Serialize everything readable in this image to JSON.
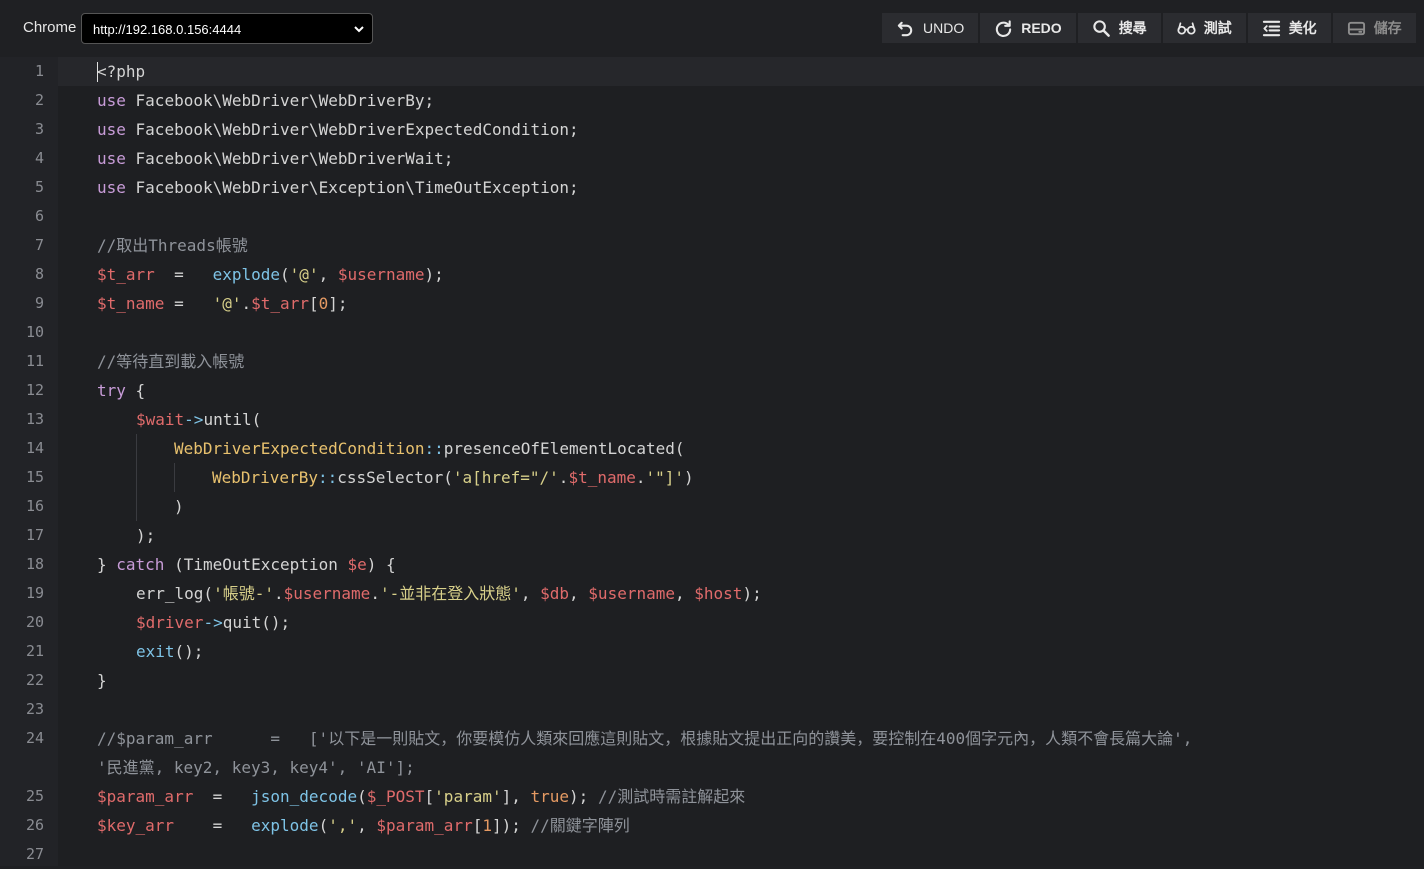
{
  "header": {
    "app_label": "Chrome",
    "url": "http://192.168.0.156:4444"
  },
  "toolbar": {
    "undo": "UNDO",
    "redo": "REDO",
    "search": "搜尋",
    "test": "測試",
    "beautify": "美化",
    "save": "儲存"
  },
  "editor": {
    "line_numbers": [
      "1",
      "2",
      "3",
      "4",
      "5",
      "6",
      "7",
      "8",
      "9",
      "10",
      "11",
      "12",
      "13",
      "14",
      "15",
      "16",
      "17",
      "18",
      "19",
      "20",
      "21",
      "22",
      "23",
      "24",
      "25",
      "26",
      "27"
    ],
    "code": {
      "l1": "<?php",
      "l2_kw": "use",
      "l2_rest": " Facebook\\WebDriver\\WebDriverBy;",
      "l3_kw": "use",
      "l3_rest": " Facebook\\WebDriver\\WebDriverExpectedCondition;",
      "l4_kw": "use",
      "l4_rest": " Facebook\\WebDriver\\WebDriverWait;",
      "l5_kw": "use",
      "l5_rest": " Facebook\\WebDriver\\Exception\\TimeOutException;",
      "l7": "//取出Threads帳號",
      "l8_var": "$t_arr",
      "l8_eq": "  =   ",
      "l8_fn": "explode",
      "l8_p1": "(",
      "l8_str": "'@'",
      "l8_p2": ", ",
      "l8_var2": "$username",
      "l8_p3": ");",
      "l9_var": "$t_name",
      "l9_eq": " =   ",
      "l9_str": "'@'",
      "l9_p1": ".",
      "l9_var2": "$t_arr",
      "l9_p2": "[",
      "l9_num": "0",
      "l9_p3": "];",
      "l11": "//等待直到載入帳號",
      "l12_kw": "try",
      "l12_rest": " {",
      "l13_var": "$wait",
      "l13_op": "->",
      "l13_rest": "until(",
      "l14_cls": "WebDriverExpectedCondition",
      "l14_op": "::",
      "l14_rest": "presenceOfElementLocated(",
      "l15_cls": "WebDriverBy",
      "l15_op": "::",
      "l15_p1": "cssSelector(",
      "l15_str1": "'a[href=\"/'",
      "l15_p2": ".",
      "l15_var": "$t_name",
      "l15_p3": ".",
      "l15_str2": "'\"]'",
      "l15_p4": ")",
      "l16": ")",
      "l17": ");",
      "l18_p1": "} ",
      "l18_kw": "catch",
      "l18_p2": " (TimeOutException ",
      "l18_var": "$e",
      "l18_p3": ") {",
      "l19_p1": "err_log(",
      "l19_str1": "'帳號-'",
      "l19_p2": ".",
      "l19_var1": "$username",
      "l19_p3": ".",
      "l19_str2": "'-並非在登入狀態'",
      "l19_p4": ", ",
      "l19_var2": "$db",
      "l19_p5": ", ",
      "l19_var3": "$username",
      "l19_p6": ", ",
      "l19_var4": "$host",
      "l19_p7": ");",
      "l20_var": "$driver",
      "l20_op": "->",
      "l20_rest": "quit();",
      "l21_fn": "exit",
      "l21_rest": "();",
      "l22": "}",
      "l24a": "//$param_arr      =   ['以下是一則貼文，你要模仿人類來回應這則貼文，根據貼文提出正向的讚美，要控制在400個字元內，人類不會長篇大論',",
      "l24b": "'民進黨, key2, key3, key4', 'AI'];",
      "l25_var": "$param_arr",
      "l25_eq": "  =   ",
      "l25_fn": "json_decode",
      "l25_p1": "(",
      "l25_var2": "$_POST",
      "l25_p2": "[",
      "l25_str": "'param'",
      "l25_p3": "], ",
      "l25_bool": "true",
      "l25_p4": "); ",
      "l25_cmt": "//測試時需註解起來",
      "l26_var": "$key_arr",
      "l26_eq": "    =   ",
      "l26_fn": "explode",
      "l26_p1": "(",
      "l26_str": "','",
      "l26_p2": ", ",
      "l26_var2": "$param_arr",
      "l26_p3": "[",
      "l26_num": "1",
      "l26_p4": "]); ",
      "l26_cmt": "//關鍵字陣列"
    }
  },
  "colors": {
    "background": "#1e1f22",
    "keyword": "#c89cd8",
    "variable": "#e06b6b",
    "string": "#d8d08a",
    "function": "#7ec3e6",
    "comment": "#8f939a",
    "class": "#e8c16e"
  }
}
